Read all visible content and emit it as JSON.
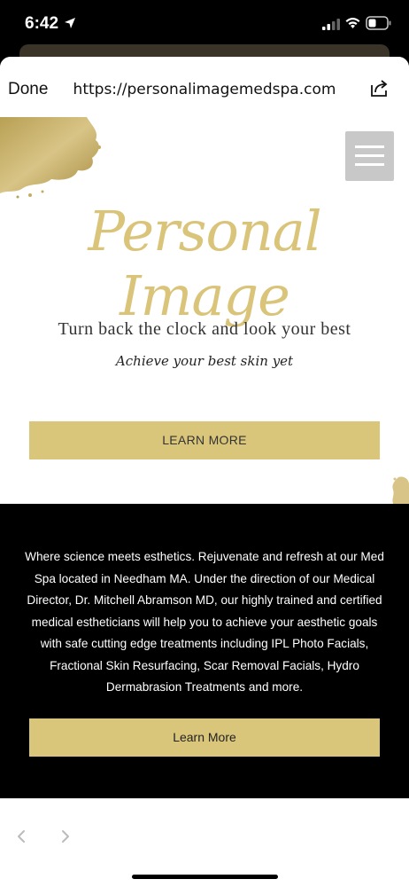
{
  "status_bar": {
    "time": "6:42"
  },
  "browser": {
    "done_label": "Done",
    "url": "https://personalimagemedspa.com"
  },
  "hero": {
    "logo": "Personal Image",
    "tagline": "Turn back the clock and look your best",
    "subtagline": "Achieve your best skin yet",
    "button_label": "LEARN MORE"
  },
  "about": {
    "description": "Where science meets esthetics. Rejuvenate and refresh at our Med Spa located in Needham MA. Under the direction of our Medical Director, Dr. Mitchell Abramson MD, our highly trained and certified medical estheticians will help you to achieve your aesthetic goals with safe cutting edge treatments including IPL Photo Facials, Fractional Skin Resurfacing, Scar Removal Facials, Hydro Dermabrasion Treatments and  more.",
    "button_label": "Learn More"
  },
  "colors": {
    "gold": "#dac67b",
    "black": "#000000",
    "menu_gray": "#c8c8c8"
  },
  "icons": [
    "location-arrow-icon",
    "signal-icon",
    "wifi-icon",
    "battery-icon",
    "share-icon",
    "hamburger-menu-icon",
    "back-arrow-icon",
    "forward-arrow-icon"
  ]
}
